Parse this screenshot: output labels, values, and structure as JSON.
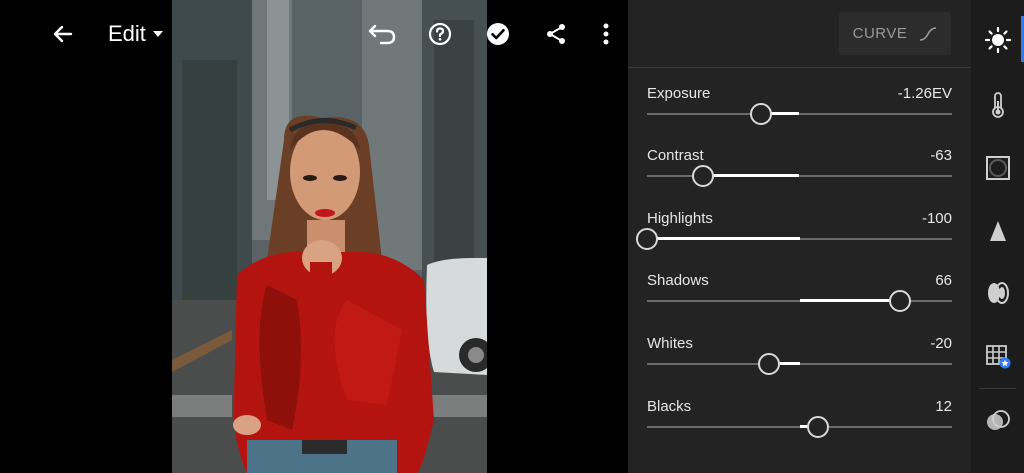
{
  "topbar": {
    "back_icon": "arrow-left-icon",
    "edit_label": "Edit",
    "edit_dropdown_icon": "caret-down-icon",
    "undo_icon": "undo-icon",
    "help_icon": "help-circle-icon",
    "done_icon": "check-circle-icon",
    "share_icon": "share-icon",
    "more_icon": "more-vertical-icon"
  },
  "panel": {
    "curve_label": "CURVE",
    "curve_icon": "curve-line-icon",
    "sliders": [
      {
        "label": "Exposure",
        "value": "-1.26EV",
        "position": 0.374
      },
      {
        "label": "Contrast",
        "value": "-63",
        "position": 0.185
      },
      {
        "label": "Highlights",
        "value": "-100",
        "position": 0.0
      },
      {
        "label": "Shadows",
        "value": "66",
        "position": 0.83
      },
      {
        "label": "Whites",
        "value": "-20",
        "position": 0.4
      },
      {
        "label": "Blacks",
        "value": "12",
        "position": 0.56
      }
    ]
  },
  "rail": {
    "items": [
      "light-icon",
      "color-icon",
      "effects-icon",
      "detail-icon",
      "optics-icon",
      "geometry-icon",
      "presets-icon"
    ]
  },
  "colors": {
    "accent": "#2f7bf6",
    "panel_bg": "#232323",
    "rail_bg": "#1c1c1c",
    "sweater_red": "#b3140f"
  }
}
